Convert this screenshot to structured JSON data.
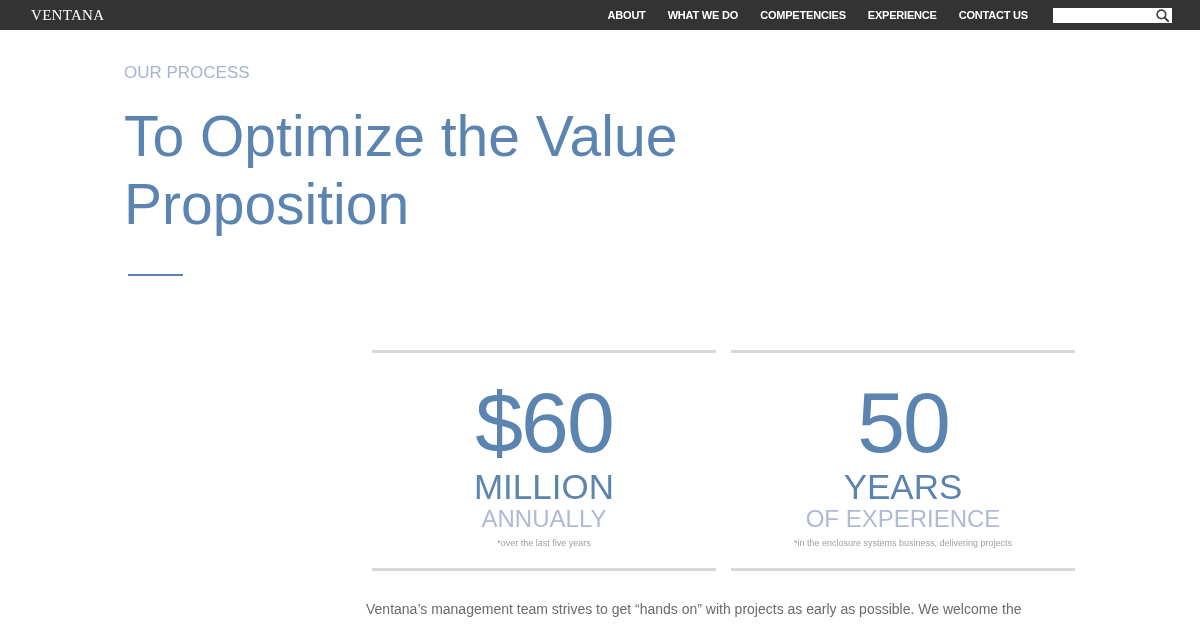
{
  "header": {
    "logo": "VENTANA",
    "nav": [
      "ABOUT",
      "WHAT WE DO",
      "COMPETENCIES",
      "EXPERIENCE",
      "CONTACT US"
    ]
  },
  "section": {
    "eyebrow": "OUR PROCESS",
    "title": "To Optimize the Value Proposition"
  },
  "stats": [
    {
      "figure": "$60",
      "unit": "MILLION",
      "qualifier": "ANNUALLY",
      "note": "*over the last five years"
    },
    {
      "figure": "50",
      "unit": "YEARS",
      "qualifier": "OF EXPERIENCE",
      "note": "*in the enclosure systems business, delivering projects"
    }
  ],
  "intro": "Ventana’s management team strives to get “hands on” with projects as early as possible. We welcome the"
}
